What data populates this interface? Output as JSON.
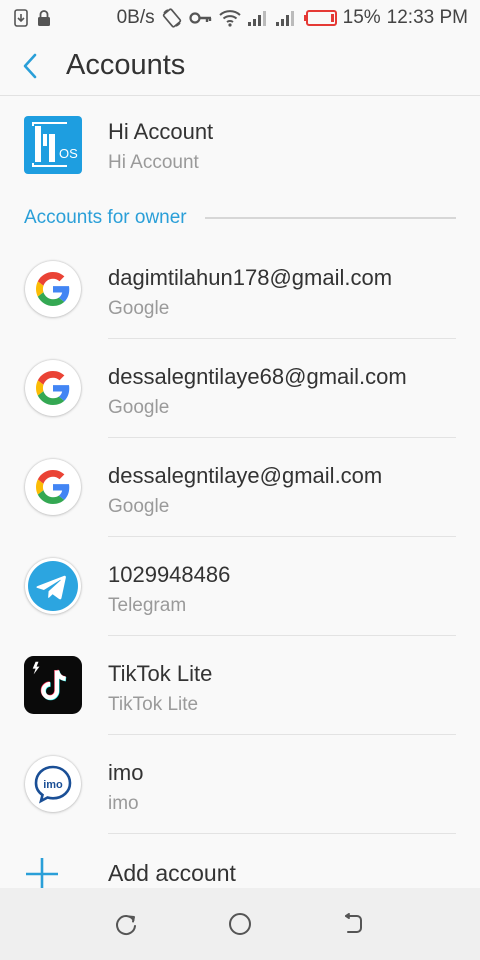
{
  "status_bar": {
    "speed": "0B/s",
    "battery": "15%",
    "time": "12:33 PM",
    "icons": [
      "download-icon",
      "lock-icon",
      "rotate-icon",
      "vpn-key-icon",
      "wifi-icon",
      "signal-icon",
      "signal-icon",
      "battery-low-icon"
    ]
  },
  "header": {
    "title": "Accounts",
    "back_icon": "chevron-left-icon"
  },
  "hi_account": {
    "name": "Hi Account",
    "type": "Hi Account",
    "icon": "hios-icon"
  },
  "section": {
    "label": "Accounts for owner"
  },
  "accounts": [
    {
      "name": "dagimtilahun178@gmail.com",
      "type": "Google",
      "icon": "google-icon"
    },
    {
      "name": "dessalegntilaye68@gmail.com",
      "type": "Google",
      "icon": "google-icon"
    },
    {
      "name": "dessalegntilaye@gmail.com",
      "type": "Google",
      "icon": "google-icon"
    },
    {
      "name": "1029948486",
      "type": "Telegram",
      "icon": "telegram-icon"
    },
    {
      "name": "TikTok Lite",
      "type": "TikTok Lite",
      "icon": "tiktok-lite-icon"
    },
    {
      "name": "imo",
      "type": "imo",
      "icon": "imo-icon"
    }
  ],
  "add_account": {
    "label": "Add account",
    "icon": "plus-icon"
  },
  "nav": {
    "icons": [
      "recent-apps-icon",
      "home-icon",
      "back-icon"
    ]
  },
  "colors": {
    "accent": "#2a9fd8",
    "background": "#f9f9f9",
    "battery_low": "#e53935",
    "telegram": "#2ca5e0",
    "hios": "#1e9ee0"
  }
}
